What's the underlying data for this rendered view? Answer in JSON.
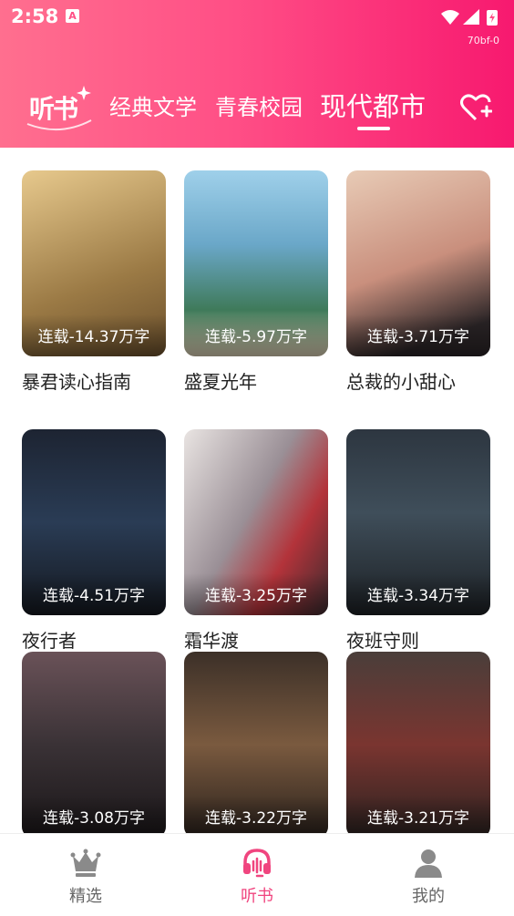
{
  "status_bar": {
    "time": "2:58",
    "notif_letter": "A",
    "build_id": "70bf-0"
  },
  "header": {
    "logo_text": "听书",
    "tabs": [
      {
        "label": "经典文学",
        "active": false
      },
      {
        "label": "青春校园",
        "active": false
      },
      {
        "label": "现代都市",
        "active": true
      }
    ],
    "fav_icon": "heart-plus-icon"
  },
  "books": [
    {
      "title": "暴君读心指南",
      "badge": "连载-14.37万字",
      "cover_color": "#b89b63"
    },
    {
      "title": "盛夏光年",
      "badge": "连载-5.97万字",
      "cover_color": "#6fa8c9"
    },
    {
      "title": "总裁的小甜心",
      "badge": "连载-3.71万字",
      "cover_color": "#c98f7d"
    },
    {
      "title": "夜行者",
      "badge": "连载-4.51万字",
      "cover_color": "#26364a"
    },
    {
      "title": "霜华渡",
      "badge": "连载-3.25万字",
      "cover_color": "#7b6f78"
    },
    {
      "title": "夜班守则",
      "badge": "连载-3.34万字",
      "cover_color": "#34404a"
    },
    {
      "title": "",
      "badge": "连载-3.08万字",
      "cover_color": "#4a3f44"
    },
    {
      "title": "",
      "badge": "连载-3.22万字",
      "cover_color": "#6d5546"
    },
    {
      "title": "",
      "badge": "连载-3.21万字",
      "cover_color": "#5a3b36"
    }
  ],
  "bottom_nav": [
    {
      "label": "精选",
      "icon": "crown-icon",
      "active": false
    },
    {
      "label": "听书",
      "icon": "headphones-icon",
      "active": true
    },
    {
      "label": "我的",
      "icon": "user-icon",
      "active": false
    }
  ]
}
